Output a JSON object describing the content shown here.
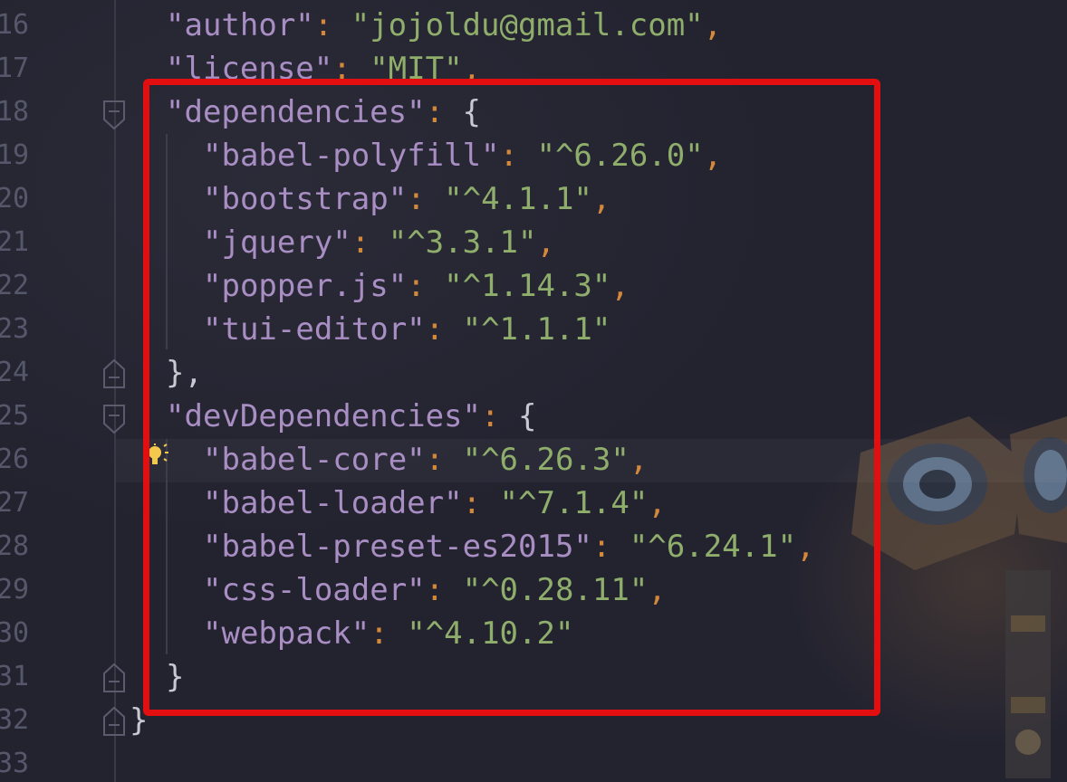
{
  "colors": {
    "key": "#a98ec4",
    "string": "#8fae6c",
    "punctuation": "#d4883a",
    "highlight": "#e30e10",
    "line_number": "#55576a"
  },
  "icons": {
    "fold": "fold-marker-icon",
    "intention": "lightbulb-icon"
  },
  "lines": [
    {
      "no": "16",
      "indent": 1,
      "key": "\"author\"",
      "sep": ": ",
      "value": "\"jojoldu@gmail.com\"",
      "trail": ","
    },
    {
      "no": "17",
      "indent": 1,
      "key": "\"license\"",
      "sep": ": ",
      "value": "\"MIT\"",
      "trail": ","
    },
    {
      "no": "18",
      "indent": 1,
      "key": "\"dependencies\"",
      "sep": ": ",
      "value": "",
      "trail": "{"
    },
    {
      "no": "19",
      "indent": 2,
      "key": "\"babel-polyfill\"",
      "sep": ": ",
      "value": "\"^6.26.0\"",
      "trail": ","
    },
    {
      "no": "20",
      "indent": 2,
      "key": "\"bootstrap\"",
      "sep": ": ",
      "value": "\"^4.1.1\"",
      "trail": ","
    },
    {
      "no": "21",
      "indent": 2,
      "key": "\"jquery\"",
      "sep": ": ",
      "value": "\"^3.3.1\"",
      "trail": ","
    },
    {
      "no": "22",
      "indent": 2,
      "key": "\"popper.js\"",
      "sep": ": ",
      "value": "\"^1.14.3\"",
      "trail": ","
    },
    {
      "no": "23",
      "indent": 2,
      "key": "\"tui-editor\"",
      "sep": ": ",
      "value": "\"^1.1.1\"",
      "trail": ""
    },
    {
      "no": "24",
      "indent": 1,
      "key": "",
      "sep": "",
      "value": "",
      "trail": "},"
    },
    {
      "no": "25",
      "indent": 1,
      "key": "\"devDependencies\"",
      "sep": ": ",
      "value": "",
      "trail": "{"
    },
    {
      "no": "26",
      "indent": 2,
      "key": "\"babel-core\"",
      "sep": ": ",
      "value": "\"^6.26.3\"",
      "trail": ","
    },
    {
      "no": "27",
      "indent": 2,
      "key": "\"babel-loader\"",
      "sep": ": ",
      "value": "\"^7.1.4\"",
      "trail": ","
    },
    {
      "no": "28",
      "indent": 2,
      "key": "\"babel-preset-es2015\"",
      "sep": ": ",
      "value": "\"^6.24.1\"",
      "trail": ","
    },
    {
      "no": "29",
      "indent": 2,
      "key": "\"css-loader\"",
      "sep": ": ",
      "value": "\"^0.28.11\"",
      "trail": ","
    },
    {
      "no": "30",
      "indent": 2,
      "key": "\"webpack\"",
      "sep": ": ",
      "value": "\"^4.10.2\"",
      "trail": ""
    },
    {
      "no": "31",
      "indent": 1,
      "key": "",
      "sep": "",
      "value": "",
      "trail": "}"
    },
    {
      "no": "32",
      "indent": 0,
      "key": "",
      "sep": "",
      "value": "",
      "trail": "}"
    },
    {
      "no": "33",
      "indent": 0,
      "key": "",
      "sep": "",
      "value": "",
      "trail": ""
    }
  ]
}
